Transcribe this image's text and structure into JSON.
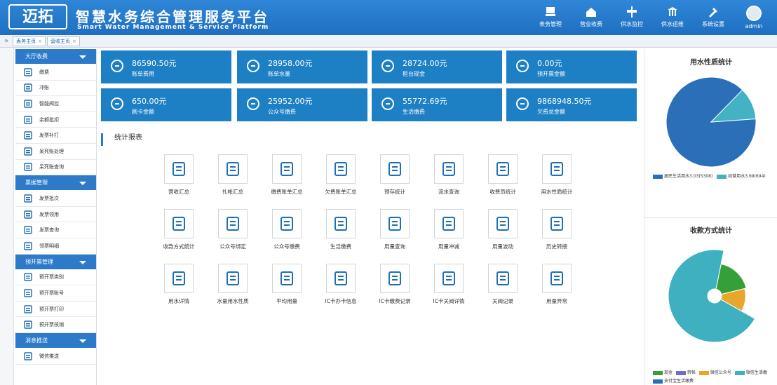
{
  "header": {
    "logo_text": "迈拓",
    "title": "智慧水务综合管理服务平台",
    "subtitle": "Smart Water Management & Service Platform",
    "nav": [
      {
        "label": "表务管理",
        "icon": "meter-icon"
      },
      {
        "label": "营业收费",
        "icon": "cashier-icon"
      },
      {
        "label": "供水监控",
        "icon": "monitor-icon"
      },
      {
        "label": "供水运维",
        "icon": "maintenance-icon"
      },
      {
        "label": "系统设置",
        "icon": "settings-icon"
      },
      {
        "label": "admin",
        "icon": "user-avatar-icon"
      }
    ]
  },
  "tabs": [
    {
      "label": "表务主页",
      "close": "×"
    },
    {
      "label": "营收主页",
      "close": "×"
    }
  ],
  "sidebar": {
    "groups": [
      {
        "label": "大厅收费",
        "items": [
          "缴费",
          "冲账",
          "智能阀控",
          "余额批扣",
          "发票补打",
          "呆死账处理",
          "呆死账查询"
        ]
      },
      {
        "label": "票据管理",
        "items": [
          "发票批次",
          "发票领用",
          "发票查询",
          "领票明细"
        ]
      },
      {
        "label": "预开票管理",
        "items": [
          "预开票类别",
          "预开票账号",
          "预开票打印",
          "预开票核销"
        ]
      },
      {
        "label": "消息推送",
        "items": [
          "微信推送"
        ]
      }
    ]
  },
  "stats": [
    {
      "amount": "86590.50元",
      "label": "账单费用"
    },
    {
      "amount": "28958.00元",
      "label": "账单水量"
    },
    {
      "amount": "28724.00元",
      "label": "柜台现金"
    },
    {
      "amount": "0.00元",
      "label": "预开票金额"
    },
    {
      "amount": "650.00元",
      "label": "刷卡金额"
    },
    {
      "amount": "25952.00元",
      "label": "公众号缴费"
    },
    {
      "amount": "55772.69元",
      "label": "生活缴费"
    },
    {
      "amount": "9868948.50元",
      "label": "欠费总金额"
    }
  ],
  "section_title": "统计报表",
  "reports": [
    [
      "营收汇总",
      "扎帐汇总",
      "缴费账单汇总",
      "欠费账单汇总",
      "预存统计",
      "流水查询",
      "收费员统计",
      "用水性质统计"
    ],
    [
      "收款方式统计",
      "公众号绑定",
      "公众号缴费",
      "生活缴费",
      "用量查询",
      "用量冲减",
      "用量波动",
      "历史转接"
    ],
    [
      "用水详情",
      "水量用水性质",
      "平均用量",
      "IC卡办卡信息",
      "IC卡缴费记录",
      "IC卡关阀详情",
      "关阀记录",
      "用量异常"
    ]
  ],
  "chart1": {
    "title": "用水性质统计",
    "colors": [
      "#2a6fb8",
      "#43b2c4"
    ],
    "legend": [
      "居民生活用水3.03(5308)",
      "经营用水3.69(694)"
    ]
  },
  "chart2": {
    "title": "收款方式统计",
    "colors": [
      "#35a03a",
      "#6b6fc7",
      "#e8a62a",
      "#3fb0c0",
      "#2a6fb8"
    ],
    "legend": [
      "现金",
      "转帐",
      "微信公众号",
      "微信生活缴",
      "支付宝生活缴费"
    ]
  },
  "chart_data": [
    {
      "type": "pie",
      "title": "用水性质统计",
      "categories": [
        "居民生活用水3.03(5308)",
        "经营用水3.69(694)"
      ],
      "values": [
        5308,
        694
      ]
    },
    {
      "type": "pie",
      "title": "收款方式统计",
      "categories": [
        "现金",
        "转帐",
        "微信公众号",
        "微信生活缴",
        "支付宝生活缴费"
      ],
      "values": [
        18,
        0,
        12,
        70,
        0
      ]
    }
  ]
}
